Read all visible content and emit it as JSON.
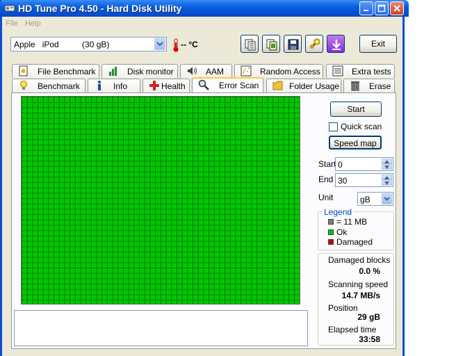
{
  "window": {
    "title": "HD Tune Pro 4.50 - Hard Disk Utility"
  },
  "menu": {
    "file": "File",
    "help": "Help"
  },
  "drive": {
    "selected": "Apple   iPod          (30 gB)"
  },
  "temperature": {
    "text": "-- °C"
  },
  "toolbar": {
    "exit_label": "Exit",
    "icons": [
      "copy-text-icon",
      "copy-screenshot-icon",
      "save-icon",
      "options-icon",
      "download-icon"
    ]
  },
  "tabs": {
    "top_row": [
      "File Benchmark",
      "Disk monitor",
      "AAM",
      "Random Access",
      "Extra tests"
    ],
    "bottom_row": [
      "Benchmark",
      "Info",
      "Health",
      "Error Scan",
      "Folder Usage",
      "Erase"
    ],
    "active": "Error Scan"
  },
  "scan": {
    "start_label": "Start",
    "quick_scan_label": "Quick scan",
    "quick_scan_checked": false,
    "speed_map_label": "Speed map",
    "start_field_label": "Start",
    "start_value": "0",
    "end_field_label": "End",
    "end_value": "30",
    "unit_label": "Unit",
    "unit_value": "gB",
    "block_state": "ok"
  },
  "legend": {
    "title": "Legend",
    "items": [
      {
        "label": "= 11 MB",
        "color": "#808080"
      },
      {
        "label": "Ok",
        "color": "#00c800"
      },
      {
        "label": "Damaged",
        "color": "#d00000"
      }
    ]
  },
  "stats": {
    "damaged_blocks_label": "Damaged blocks",
    "damaged_blocks_value": "0.0 %",
    "scanning_speed_label": "Scanning speed",
    "scanning_speed_value": "14.7 MB/s",
    "position_label": "Position",
    "position_value": "29 gB",
    "elapsed_label": "Elapsed time",
    "elapsed_value": "33:58"
  },
  "colors": {
    "block_ok": "#00c800",
    "block_damaged": "#d00000",
    "titlebar": "#0a5ee0"
  }
}
